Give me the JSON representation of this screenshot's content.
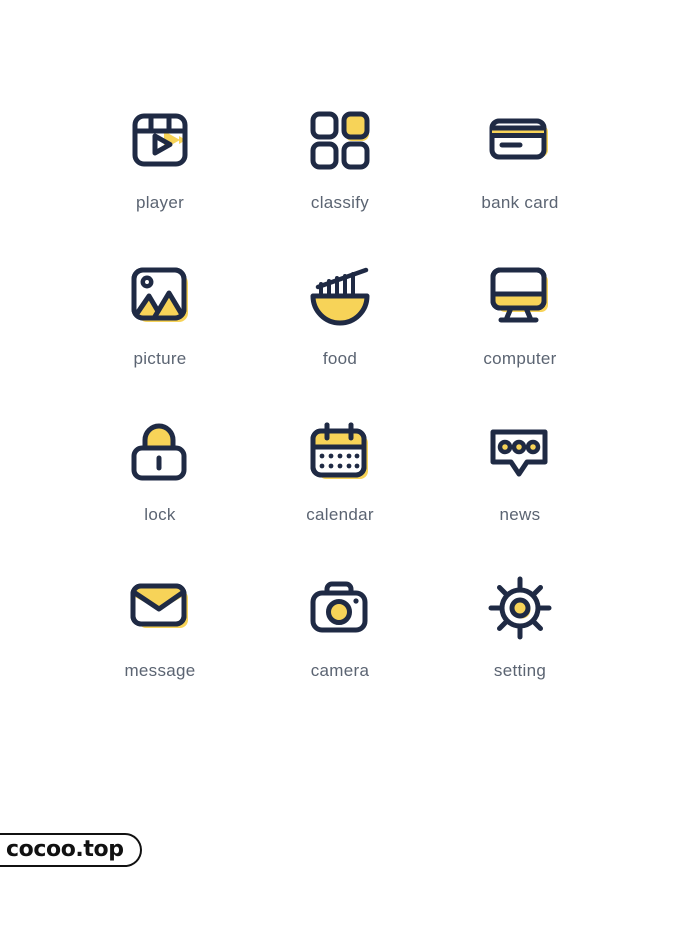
{
  "palette": {
    "background": "#ffffff",
    "stroke_dark": "#1f2a44",
    "accent_yellow": "#f7d358",
    "label_text": "#5b6472",
    "logo_black": "#111111"
  },
  "icons": [
    {
      "id": "player",
      "label": "player",
      "icon_name": "player-icon"
    },
    {
      "id": "classify",
      "label": "classify",
      "icon_name": "classify-icon"
    },
    {
      "id": "bank_card",
      "label": "bank card",
      "icon_name": "bank-card-icon"
    },
    {
      "id": "picture",
      "label": "picture",
      "icon_name": "picture-icon"
    },
    {
      "id": "food",
      "label": "food",
      "icon_name": "food-icon"
    },
    {
      "id": "computer",
      "label": "computer",
      "icon_name": "computer-icon"
    },
    {
      "id": "lock",
      "label": "lock",
      "icon_name": "lock-icon"
    },
    {
      "id": "calendar",
      "label": "calendar",
      "icon_name": "calendar-icon"
    },
    {
      "id": "news",
      "label": "news",
      "icon_name": "news-icon"
    },
    {
      "id": "message",
      "label": "message",
      "icon_name": "message-icon"
    },
    {
      "id": "camera",
      "label": "camera",
      "icon_name": "camera-icon"
    },
    {
      "id": "setting",
      "label": "setting",
      "icon_name": "setting-icon"
    }
  ],
  "footer": {
    "logo_text": "cocoo.top"
  }
}
